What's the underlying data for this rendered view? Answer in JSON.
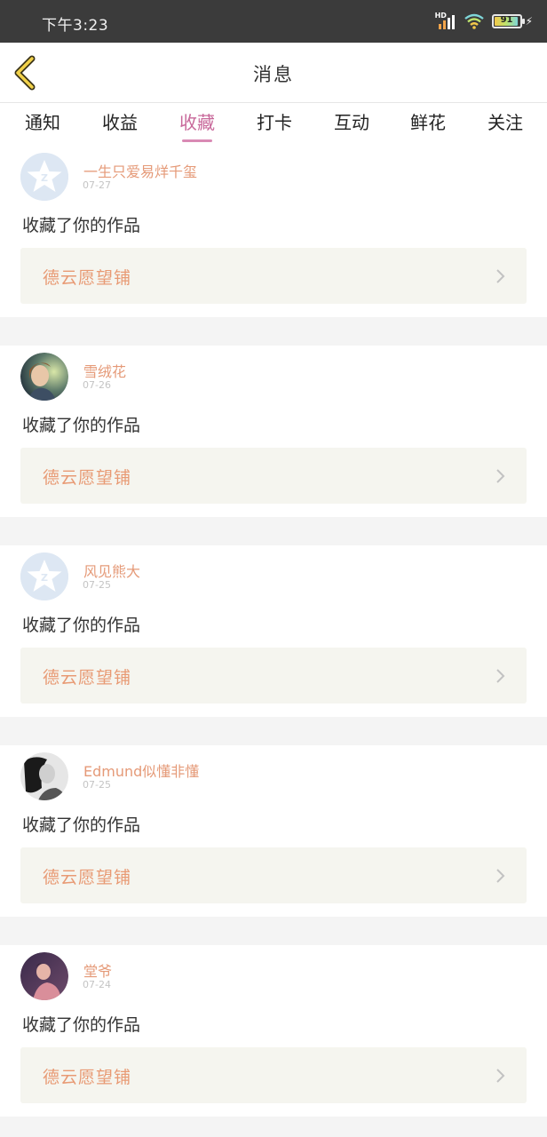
{
  "status_bar": {
    "time": "下午3:23",
    "signal_label": "HD",
    "battery_level": "91"
  },
  "nav": {
    "title": "消息"
  },
  "tabs": [
    {
      "label": "通知",
      "active": false
    },
    {
      "label": "收益",
      "active": false
    },
    {
      "label": "收藏",
      "active": true
    },
    {
      "label": "打卡",
      "active": false
    },
    {
      "label": "互动",
      "active": false
    },
    {
      "label": "鲜花",
      "active": false
    },
    {
      "label": "关注",
      "active": false
    }
  ],
  "colors": {
    "accent": "#c8689a",
    "username": "#e59a78",
    "item_text": "#e89a74",
    "item_bg": "#f5f5ef",
    "status_bg": "#3b3b3b"
  },
  "notifications": [
    {
      "user": "一生只爱易烊千玺",
      "date": "07-27",
      "action": "收藏了你的作品",
      "item": "德云愿望铺",
      "avatar": "default-qq-icon"
    },
    {
      "user": "雪绒花",
      "date": "07-26",
      "action": "收藏了你的作品",
      "item": "德云愿望铺",
      "avatar": "photo-girl"
    },
    {
      "user": "风见熊大",
      "date": "07-25",
      "action": "收藏了你的作品",
      "item": "德云愿望铺",
      "avatar": "default-qq-icon"
    },
    {
      "user": "Edmund似懂非懂",
      "date": "07-25",
      "action": "收藏了你的作品",
      "item": "德云愿望铺",
      "avatar": "photo-bw"
    },
    {
      "user": "堂爷",
      "date": "07-24",
      "action": "收藏了你的作品",
      "item": "德云愿望铺",
      "avatar": "photo-purple"
    }
  ]
}
